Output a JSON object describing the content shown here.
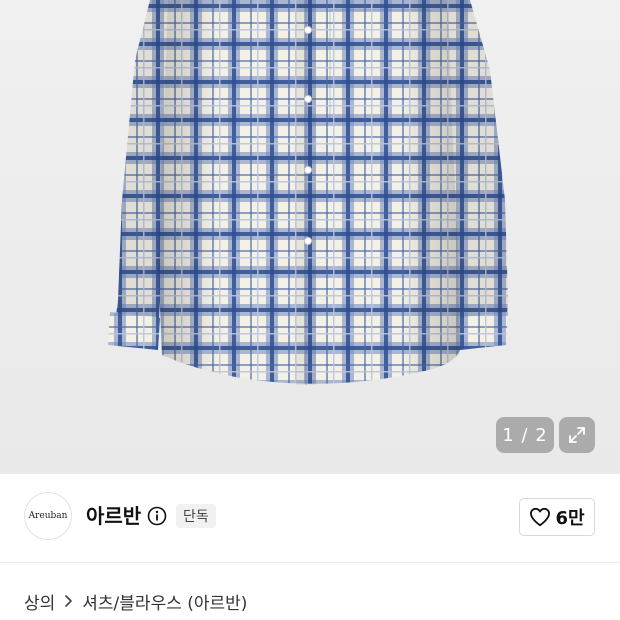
{
  "gallery": {
    "counter": "1 / 2",
    "image_icon": "plaid-shirt-photo",
    "expand_icon": "expand-arrows-icon"
  },
  "brand": {
    "logo_text": "Areuban",
    "name": "아르반",
    "info_icon": "info-circle-icon",
    "badge": "단독"
  },
  "like": {
    "icon": "heart-outline-icon",
    "count": "6만"
  },
  "breadcrumb": {
    "items": [
      "상의",
      "셔츠/블라우스 (아르반)"
    ],
    "separator_icon": "chevron-right-icon"
  },
  "colors": {
    "plaid_blue": "#4d6aa6",
    "plaid_cream": "#f4f1e8",
    "badge_bg": "#f1f1f1"
  }
}
